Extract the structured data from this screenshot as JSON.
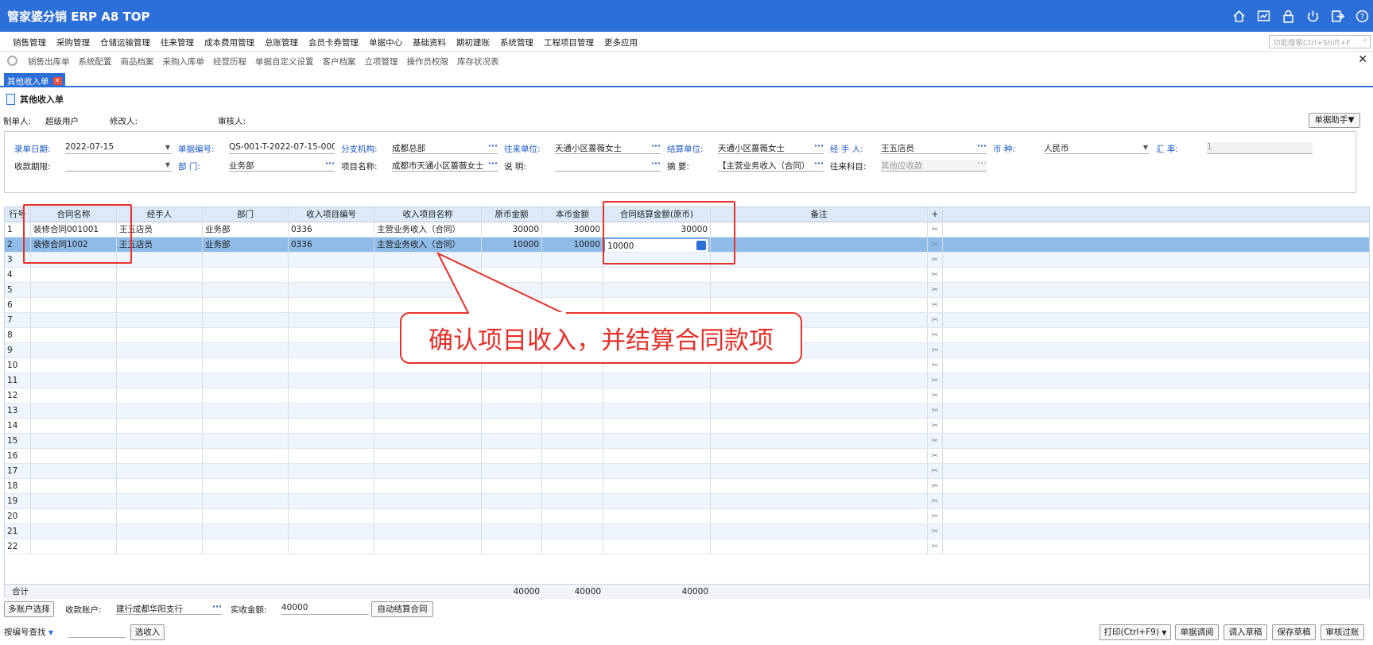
{
  "app": {
    "title": "管家婆分销 ERP A8 TOP"
  },
  "menu": [
    "销售管理",
    "采购管理",
    "仓储运输管理",
    "往来管理",
    "成本费用管理",
    "总账管理",
    "会员卡券管理",
    "单据中心",
    "基础资料",
    "期初建账",
    "系统管理",
    "工程项目管理",
    "更多应用"
  ],
  "search": {
    "placeholder": "功能搜索Ctrl+Shift+F"
  },
  "quick": [
    "销售出库单",
    "系统配置",
    "商品档案",
    "采购入库单",
    "经营历程",
    "单据自定义设置",
    "客户档案",
    "立项管理",
    "操作员权限",
    "库存状况表"
  ],
  "tab": {
    "label": "其他收入单"
  },
  "doc": {
    "title": "其他收入单",
    "maker_label": "制单人:",
    "maker": "超级用户",
    "modifier_label": "修改人:",
    "auditor_label": "审核人:",
    "helper": "单据助手▼"
  },
  "form": {
    "date_label": "录单日期:",
    "date": "2022-07-15",
    "no_label": "单据编号:",
    "no": "QS-001-T-2022-07-15-000",
    "branch_label": "分支机构:",
    "branch": "成都总部",
    "partner_label": "往来单位:",
    "partner": "天通小区蔷薇女士",
    "settle_label": "结算单位:",
    "settle": "天通小区蔷薇女士",
    "handler_label": "经 手 人:",
    "handler": "王五店员",
    "currency_label": "币    种:",
    "currency": "人民币",
    "rate_label": "汇    率:",
    "rate": "1",
    "term_label": "收款期限:",
    "term": "",
    "dept_label": "部    门:",
    "dept": "业务部",
    "project_label": "项目名称:",
    "project": "成都市天通小区蔷薇女士",
    "note_label": "说    明:",
    "note": "",
    "summary_label": "摘    要:",
    "summary": "【主营业务收入（合同）",
    "account_label": "往来科目:",
    "account": "其他应收款"
  },
  "grid": {
    "headers": [
      "行号",
      "合同名称",
      "经手人",
      "部门",
      "收入项目编号",
      "收入项目名称",
      "原币金额",
      "本币金额",
      "合同结算金额(原币)",
      "备注",
      "+"
    ],
    "rows": [
      {
        "no": "1",
        "contract": "装修合同001001",
        "handler": "王五店员",
        "dept": "业务部",
        "code": "0336",
        "item": "主营业务收入（合同）",
        "orig": "30000",
        "local": "30000",
        "settle": "30000"
      },
      {
        "no": "2",
        "contract": "装修合同1002",
        "handler": "王五店员",
        "dept": "业务部",
        "code": "0336",
        "item": "主营业务收入（合同）",
        "orig": "10000",
        "local": "10000",
        "settle": "10000"
      }
    ],
    "empty_rows": [
      "3",
      "4",
      "5",
      "6",
      "7",
      "8",
      "9",
      "10",
      "11",
      "12",
      "13",
      "14",
      "15",
      "16",
      "17",
      "18",
      "19",
      "20",
      "21",
      "22"
    ],
    "total": {
      "label": "合计",
      "orig": "40000",
      "local": "40000",
      "settle": "40000"
    }
  },
  "callout": "确认项目收入，并结算合同款项",
  "bottom": {
    "multi_account": "多账户选择",
    "account_label": "收款账户:",
    "account": "建行成都华阳支行",
    "paid_label": "实收金额:",
    "paid": "40000",
    "auto_settle": "自动结算合同",
    "find_label": "按编号查找",
    "pick_income": "选收入",
    "print": "打印(Ctrl+F9)",
    "retrieve": "单据调阅",
    "load_draft": "调入草稿",
    "save_draft": "保存草稿",
    "audit": "审核过账"
  }
}
